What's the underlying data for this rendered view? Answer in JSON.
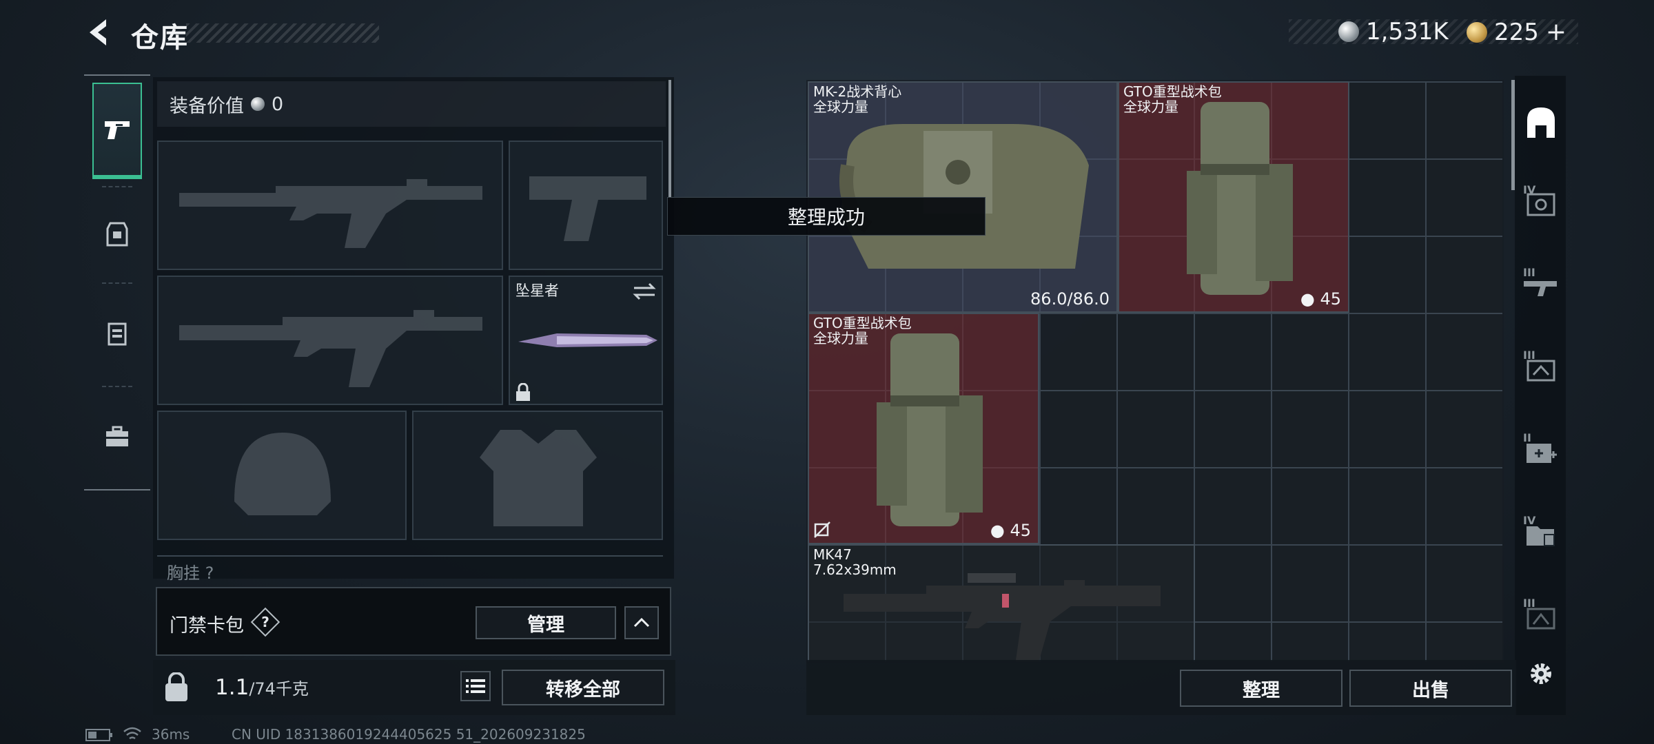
{
  "header": {
    "title": "仓库",
    "silver": "1,531K",
    "gold": "225",
    "gold_add": "+"
  },
  "loadout": {
    "value_label": "装备价值",
    "value": "0",
    "melee_name": "坠星者",
    "chest_label": "胸挂",
    "chest_count": "?"
  },
  "keycard": {
    "label": "门禁卡包",
    "help": "?",
    "manage": "管理"
  },
  "capacity": {
    "current": "1.1",
    "max": "/74千克",
    "transfer_all": "转移全部"
  },
  "toast": "整理成功",
  "storage": {
    "items": [
      {
        "name": "MK-2战术背心",
        "sub": "全球力量",
        "corner": "86.0/86.0"
      },
      {
        "name": "GTO重型战术包",
        "sub": "全球力量",
        "corner": "45"
      },
      {
        "name": "GTO重型战术包",
        "sub": "全球力量",
        "corner": "45"
      },
      {
        "name": "MK47",
        "sub": "7.62x39mm",
        "corner": ""
      }
    ],
    "sort": "整理",
    "sell": "出售"
  },
  "categories": [
    {
      "icon": "backpack-icon",
      "tier": ""
    },
    {
      "icon": "armor-vest-icon",
      "tier": "IV"
    },
    {
      "icon": "weapon-rifle-icon",
      "tier": "III"
    },
    {
      "icon": "ammo-crate-icon",
      "tier": "III"
    },
    {
      "icon": "medkit-icon",
      "tier": "II"
    },
    {
      "icon": "folder-doc-icon",
      "tier": "IV"
    },
    {
      "icon": "rank-icon",
      "tier": "III"
    }
  ],
  "status": {
    "ping": "36ms",
    "uid": "CN UID 1831386019244405625 51_202609231825"
  }
}
